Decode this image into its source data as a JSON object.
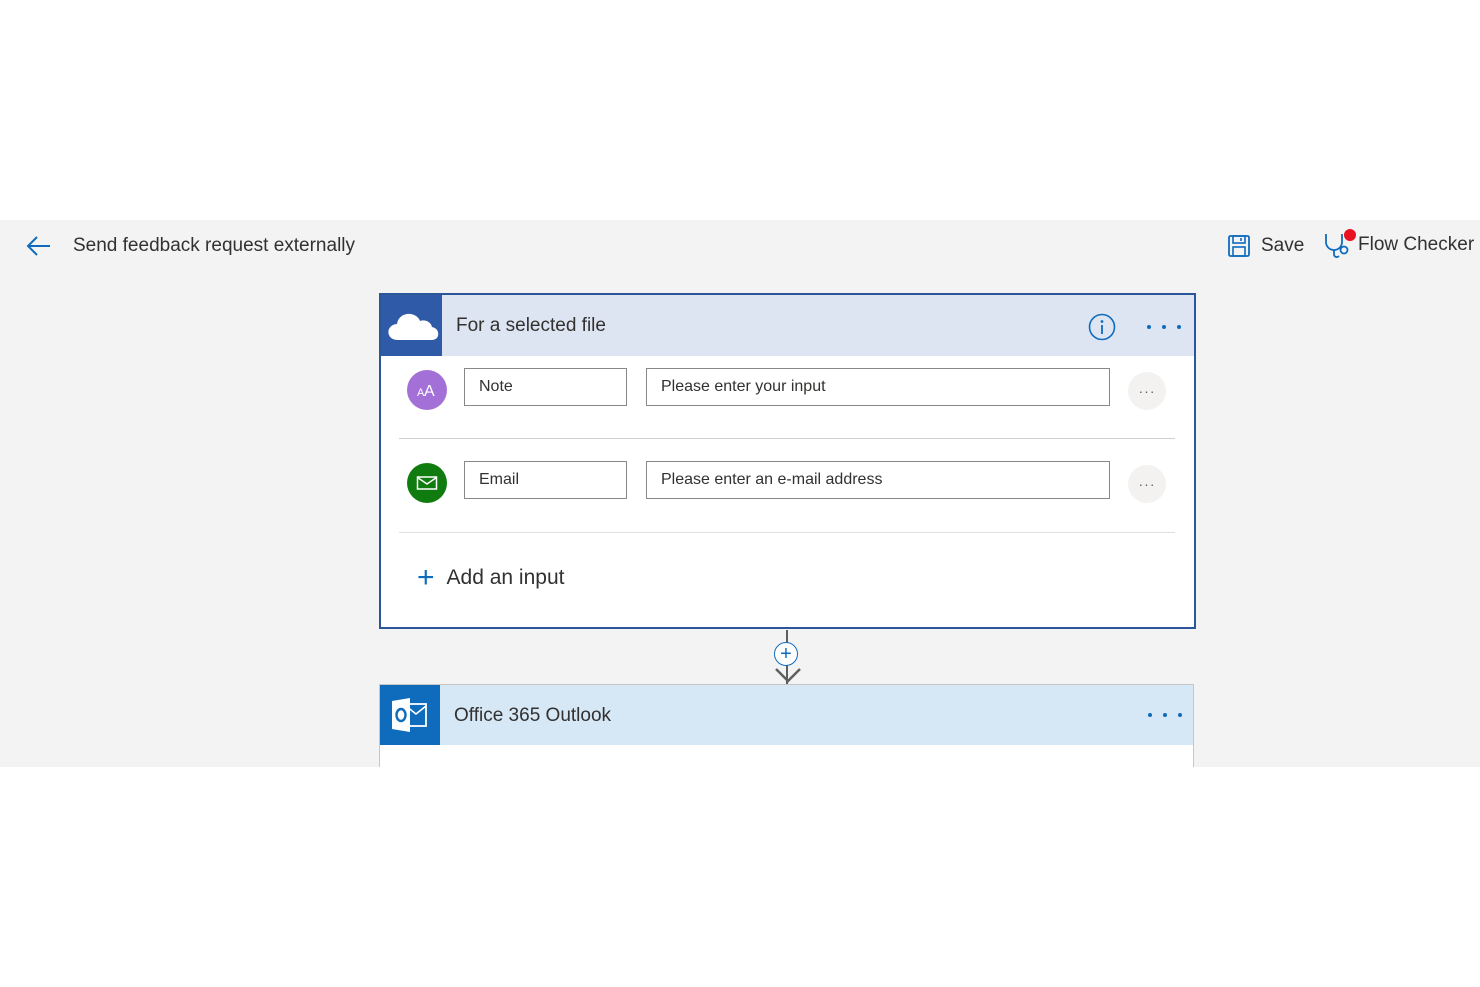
{
  "header": {
    "title": "Send feedback request externally",
    "save_label": "Save",
    "flow_checker_label": "Flow Checker",
    "back_icon": "back-arrow-icon",
    "save_icon": "floppy-disk-icon",
    "flow_checker_icon": "stethoscope-icon",
    "flow_checker_alert_color": "#e81123"
  },
  "trigger_card": {
    "title": "For a selected file",
    "connector_icon": "onedrive-cloud-icon",
    "accent_color": "#2f5aa8",
    "inputs": [
      {
        "type_icon": "text-input-icon",
        "icon_color": "#a270d6",
        "name": "Note",
        "placeholder": "Please enter your input",
        "more": "···"
      },
      {
        "type_icon": "email-input-icon",
        "icon_color": "#107c10",
        "name": "Email",
        "placeholder": "Please enter an e-mail address",
        "more": "···"
      }
    ],
    "add_input_label": "Add an input",
    "add_input_symbol": "+"
  },
  "connector": {
    "insert_symbol": "+"
  },
  "action_card": {
    "title": "Office 365 Outlook",
    "connector_icon": "outlook-icon",
    "accent_color": "#0f6cbd"
  }
}
